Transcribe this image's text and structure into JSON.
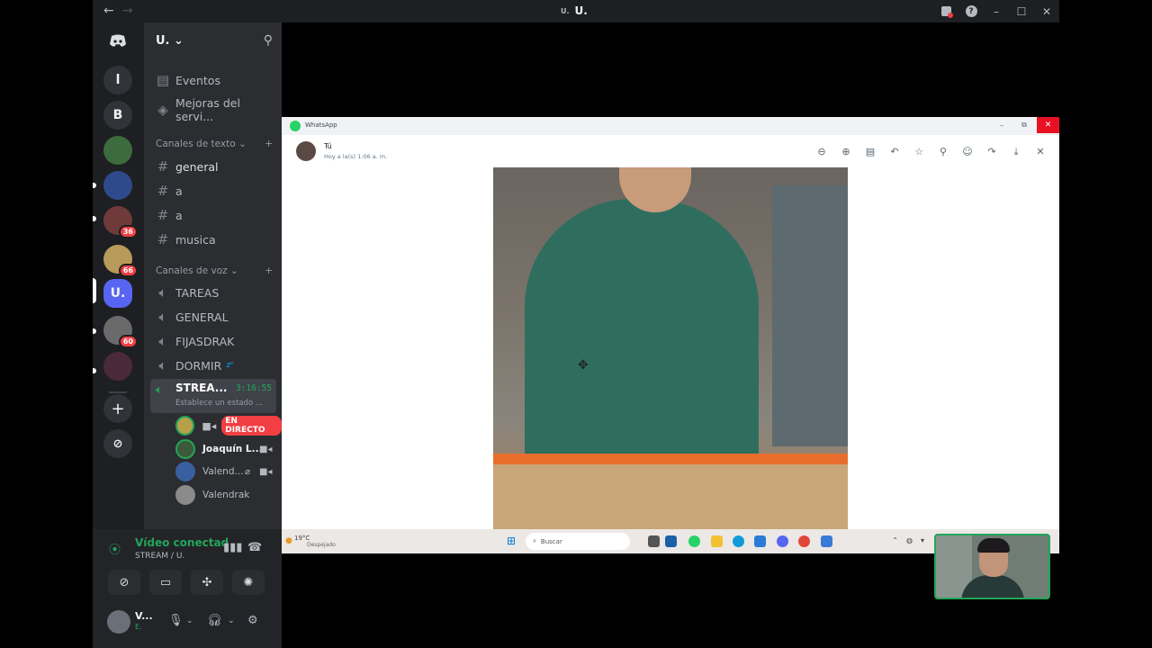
{
  "titlebar": {
    "title": "U.",
    "server_mini": "U.",
    "back": "←",
    "forward": "→",
    "inbox_icon": "▣",
    "help_icon": "?",
    "minimize": "–",
    "maximize": "☐",
    "close": "✕"
  },
  "servers": {
    "home_icon": "discord-logo",
    "items": [
      {
        "label": "l"
      },
      {
        "label": "B"
      },
      {
        "label": ""
      },
      {
        "label": ""
      },
      {
        "label": "",
        "badge": "36"
      },
      {
        "label": "",
        "badge": "66"
      },
      {
        "label": "U."
      },
      {
        "label": "",
        "badge": "60"
      },
      {
        "label": ""
      }
    ],
    "add": "+",
    "explore": "⊘"
  },
  "guild": {
    "name": "U.",
    "top_items": [
      {
        "icon": "calendar-icon",
        "label": "Eventos"
      },
      {
        "icon": "boost-icon",
        "label": "Mejoras del servi..."
      }
    ],
    "text_category": "Canales de texto",
    "text_channels": [
      "general",
      "a",
      "a",
      "musica"
    ],
    "voice_category": "Canales de voz",
    "voice_channels": [
      "TAREAS",
      "GENERAL",
      "FIJASDRAK",
      "DORMIR"
    ],
    "dormir_tag": "zᶻ",
    "active_voice": {
      "name": "STREA...",
      "time": "3:16:55",
      "status": "Establece un estado ..."
    },
    "voice_users": [
      {
        "name": "",
        "live": "EN DIRECTO"
      },
      {
        "name": "Joaquín L..."
      },
      {
        "name": "Valend..."
      },
      {
        "name": "Valendrak"
      }
    ]
  },
  "rtc": {
    "title": "Vídeo conectad",
    "subtitle": "STREAM / U."
  },
  "user": {
    "name": "V...",
    "status": "E."
  },
  "whatsapp": {
    "app_title": "WhatsApp",
    "sender": "Tú",
    "timestamp": "Hoy a la(s) 1:06 a. m.",
    "taskbar": {
      "temp": "19°C",
      "weather": "Despejado",
      "search_placeholder": "Buscar"
    }
  },
  "colors": {
    "discord_green": "#23a55a",
    "live_red": "#f23f43",
    "blurple": "#5865f2",
    "whatsapp_green": "#25d366"
  }
}
